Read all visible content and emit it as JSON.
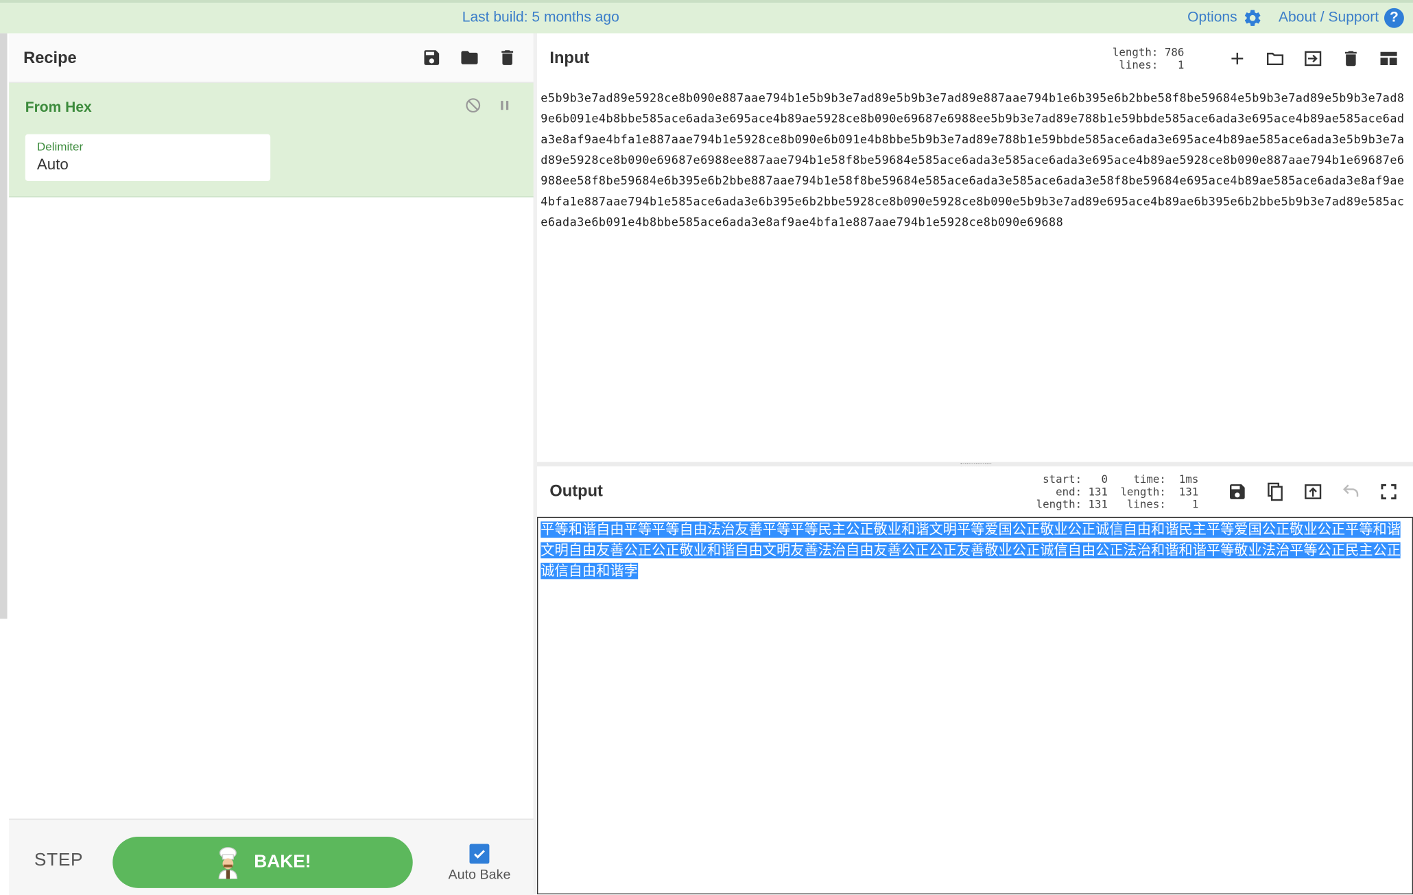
{
  "banner": {
    "build_text": "Last build: 5 months ago",
    "options_label": "Options",
    "about_label": "About / Support",
    "help_glyph": "?"
  },
  "recipe": {
    "title": "Recipe",
    "operation": {
      "name": "From Hex",
      "field_label": "Delimiter",
      "field_value": "Auto"
    },
    "controls": {
      "step_label": "STEP",
      "bake_label": "BAKE!",
      "auto_bake_label": "Auto Bake",
      "auto_bake_checked": true
    }
  },
  "input": {
    "title": "Input",
    "stats": "length: 786\n lines:   1",
    "text": "e5b9b3e7ad89e5928ce8b090e887aae794b1e5b9b3e7ad89e5b9b3e7ad89e887aae794b1e6b395e6b2bbe58f8be59684e5b9b3e7ad89e5b9b3e7ad89e6b091e4b8bbe585ace6ada3e695ace4b89ae5928ce8b090e69687e6988ee5b9b3e7ad89e788b1e59bbde585ace6ada3e695ace4b89ae585ace6ada3e8af9ae4bfa1e887aae794b1e5928ce8b090e6b091e4b8bbe5b9b3e7ad89e788b1e59bbde585ace6ada3e695ace4b89ae585ace6ada3e5b9b3e7ad89e5928ce8b090e69687e6988ee887aae794b1e58f8be59684e585ace6ada3e585ace6ada3e695ace4b89ae5928ce8b090e887aae794b1e69687e6988ee58f8be59684e6b395e6b2bbe887aae794b1e58f8be59684e585ace6ada3e585ace6ada3e58f8be59684e695ace4b89ae585ace6ada3e8af9ae4bfa1e887aae794b1e585ace6ada3e6b395e6b2bbe5928ce8b090e5928ce8b090e5b9b3e7ad89e695ace4b89ae6b395e6b2bbe5b9b3e7ad89e585ace6ada3e6b091e4b8bbe585ace6ada3e8af9ae4bfa1e887aae794b1e5928ce8b090e69688"
  },
  "output": {
    "title": "Output",
    "stats_left": "start:   0\n  end: 131\nlength: 131",
    "stats_right": "  time:  1ms\nlength:  131\n lines:    1",
    "text": "平等和谐自由平等平等自由法治友善平等平等民主公正敬业和谐文明平等爱国公正敬业公正诚信自由和谐民主平等爱国公正敬业公正平等和谐文明自由友善公正公正敬业和谐自由文明友善法治自由友善公正公正友善敬业公正诚信自由公正法治和谐和谐平等敬业法治平等公正民主公正诚信自由和谐孛"
  },
  "colors": {
    "banner_bg": "#dff0d8",
    "link": "#3a7dc9",
    "operation_title": "#3c8b3c",
    "bake_button": "#5cb85c",
    "selection": "#3390ff"
  },
  "icons": {
    "gear": "gear-icon",
    "help": "help-icon",
    "save": "save-icon",
    "folder": "folder-icon",
    "trash": "trash-icon",
    "plus": "plus-icon",
    "input_to_output": "file-import-icon",
    "layout": "layout-icon",
    "copy": "copy-icon",
    "replace_input": "replace-input-icon",
    "undo": "undo-icon",
    "maximise": "maximise-icon",
    "disable": "disable-icon",
    "breakpoint": "pause-icon",
    "chef": "chef-icon",
    "check": "checkmark-icon"
  }
}
